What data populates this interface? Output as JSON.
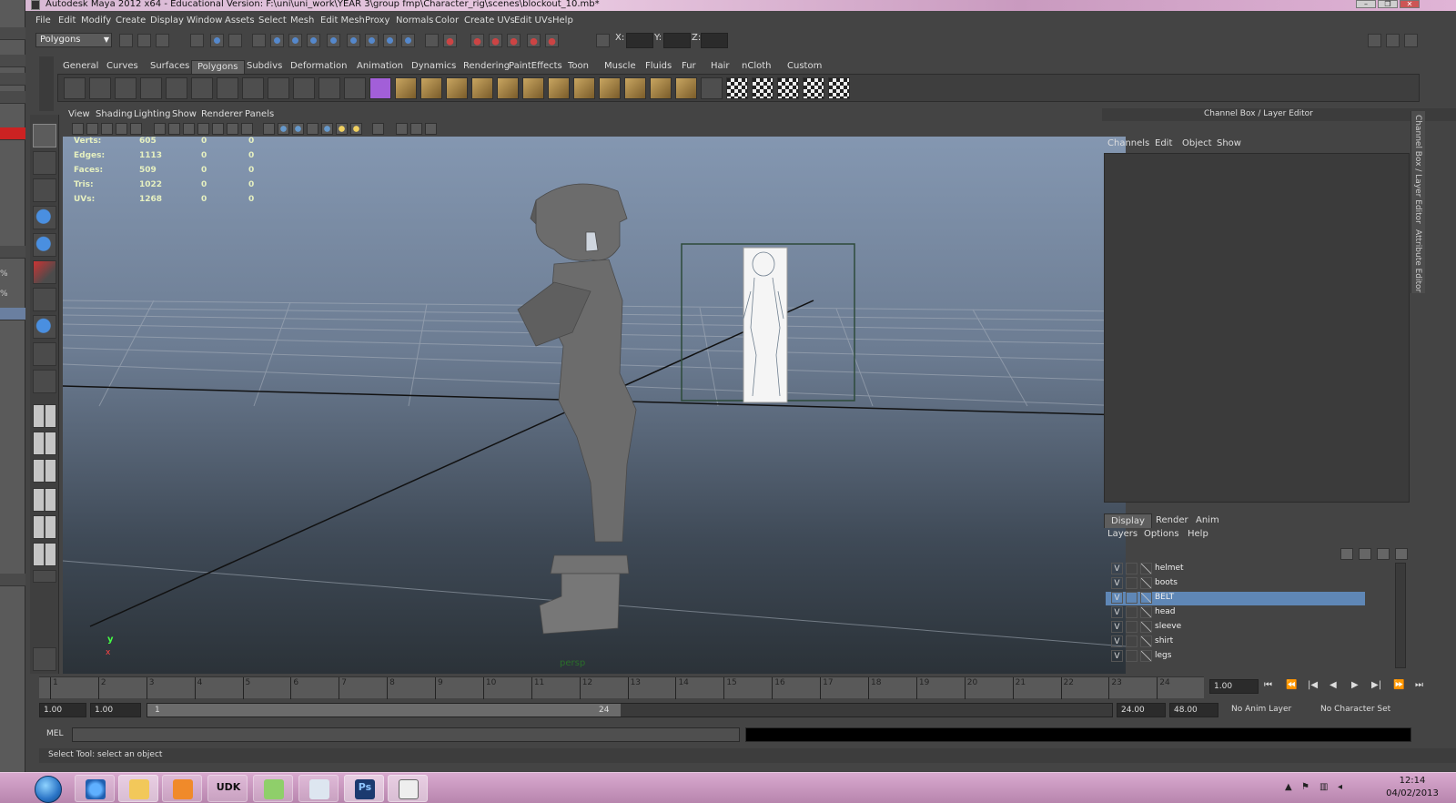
{
  "window": {
    "title": "Autodesk Maya 2012 x64 - Educational Version: F:\\uni\\uni_work\\YEAR 3\\group fmp\\Character_rig\\scenes\\blockout_10.mb*",
    "controls": [
      "–",
      "❐",
      "✕"
    ]
  },
  "desktop_left": {
    "labels": [
      "%",
      "%"
    ]
  },
  "menubar": {
    "items": [
      "File",
      "Edit",
      "Modify",
      "Create",
      "Display",
      "Window",
      "Assets",
      "Select",
      "Mesh",
      "Edit Mesh",
      "Proxy",
      "Normals",
      "Color",
      "Create UVs",
      "Edit UVs",
      "Help"
    ]
  },
  "statusline": {
    "mode": "Polygons",
    "x_label": "X:",
    "y_label": "Y:",
    "z_label": "Z:"
  },
  "shelf": {
    "tabs": [
      "General",
      "Curves",
      "Surfaces",
      "Polygons",
      "Subdivs",
      "Deformation",
      "Animation",
      "Dynamics",
      "Rendering",
      "PaintEffects",
      "Toon",
      "Muscle",
      "Fluids",
      "Fur",
      "Hair",
      "nCloth",
      "Custom"
    ],
    "active_tab": "Polygons"
  },
  "panel": {
    "menu": [
      "View",
      "Shading",
      "Lighting",
      "Show",
      "Renderer",
      "Panels"
    ],
    "camera": "persp",
    "axis_y": "y",
    "axis_x": "x"
  },
  "hud": {
    "rows": [
      {
        "label": "Verts:",
        "a": "605",
        "b": "0",
        "c": "0"
      },
      {
        "label": "Edges:",
        "a": "1113",
        "b": "0",
        "c": "0"
      },
      {
        "label": "Faces:",
        "a": "509",
        "b": "0",
        "c": "0"
      },
      {
        "label": "Tris:",
        "a": "1022",
        "b": "0",
        "c": "0"
      },
      {
        "label": "UVs:",
        "a": "1268",
        "b": "0",
        "c": "0"
      }
    ]
  },
  "channelbox": {
    "title": "Channel Box / Layer Editor",
    "menu": [
      "Channels",
      "Edit",
      "Object",
      "Show"
    ],
    "side_tabs": [
      "Channel Box / Layer Editor",
      "Attribute Editor"
    ]
  },
  "layer_editor": {
    "tabs": [
      "Display",
      "Render",
      "Anim"
    ],
    "active_tab": "Display",
    "menu": [
      "Layers",
      "Options",
      "Help"
    ],
    "layers": [
      {
        "visible": "V",
        "name": "helmet",
        "selected": false
      },
      {
        "visible": "V",
        "name": "boots",
        "selected": false
      },
      {
        "visible": "V",
        "name": "BELT",
        "selected": true
      },
      {
        "visible": "V",
        "name": "head",
        "selected": false
      },
      {
        "visible": "V",
        "name": "sleeve",
        "selected": false
      },
      {
        "visible": "V",
        "name": "shirt",
        "selected": false
      },
      {
        "visible": "V",
        "name": "legs",
        "selected": false
      }
    ]
  },
  "timeline": {
    "ticks": [
      "1",
      "2",
      "3",
      "4",
      "5",
      "6",
      "7",
      "8",
      "9",
      "10",
      "11",
      "12",
      "13",
      "14",
      "15",
      "16",
      "17",
      "18",
      "19",
      "20",
      "21",
      "22",
      "23",
      "24"
    ],
    "current_frame": "1.00",
    "playback_buttons": [
      "⏮",
      "⏪",
      "|◀",
      "◀",
      "▶",
      "▶|",
      "⏩",
      "⏭"
    ]
  },
  "range": {
    "start": "1.00",
    "playback_start": "1.00",
    "handle_start": "1",
    "handle_end": "24",
    "playback_end": "24.00",
    "end": "48.00",
    "anim_layer": "No Anim Layer",
    "character_set": "No Character Set"
  },
  "cmdline": {
    "label": "MEL"
  },
  "helpline": {
    "text": "Select Tool: select an object"
  },
  "taskbar": {
    "apps": [
      "",
      "",
      "",
      "",
      "UDK",
      "",
      "",
      "Ps",
      ""
    ],
    "time": "12:14",
    "date": "04/02/2013"
  }
}
